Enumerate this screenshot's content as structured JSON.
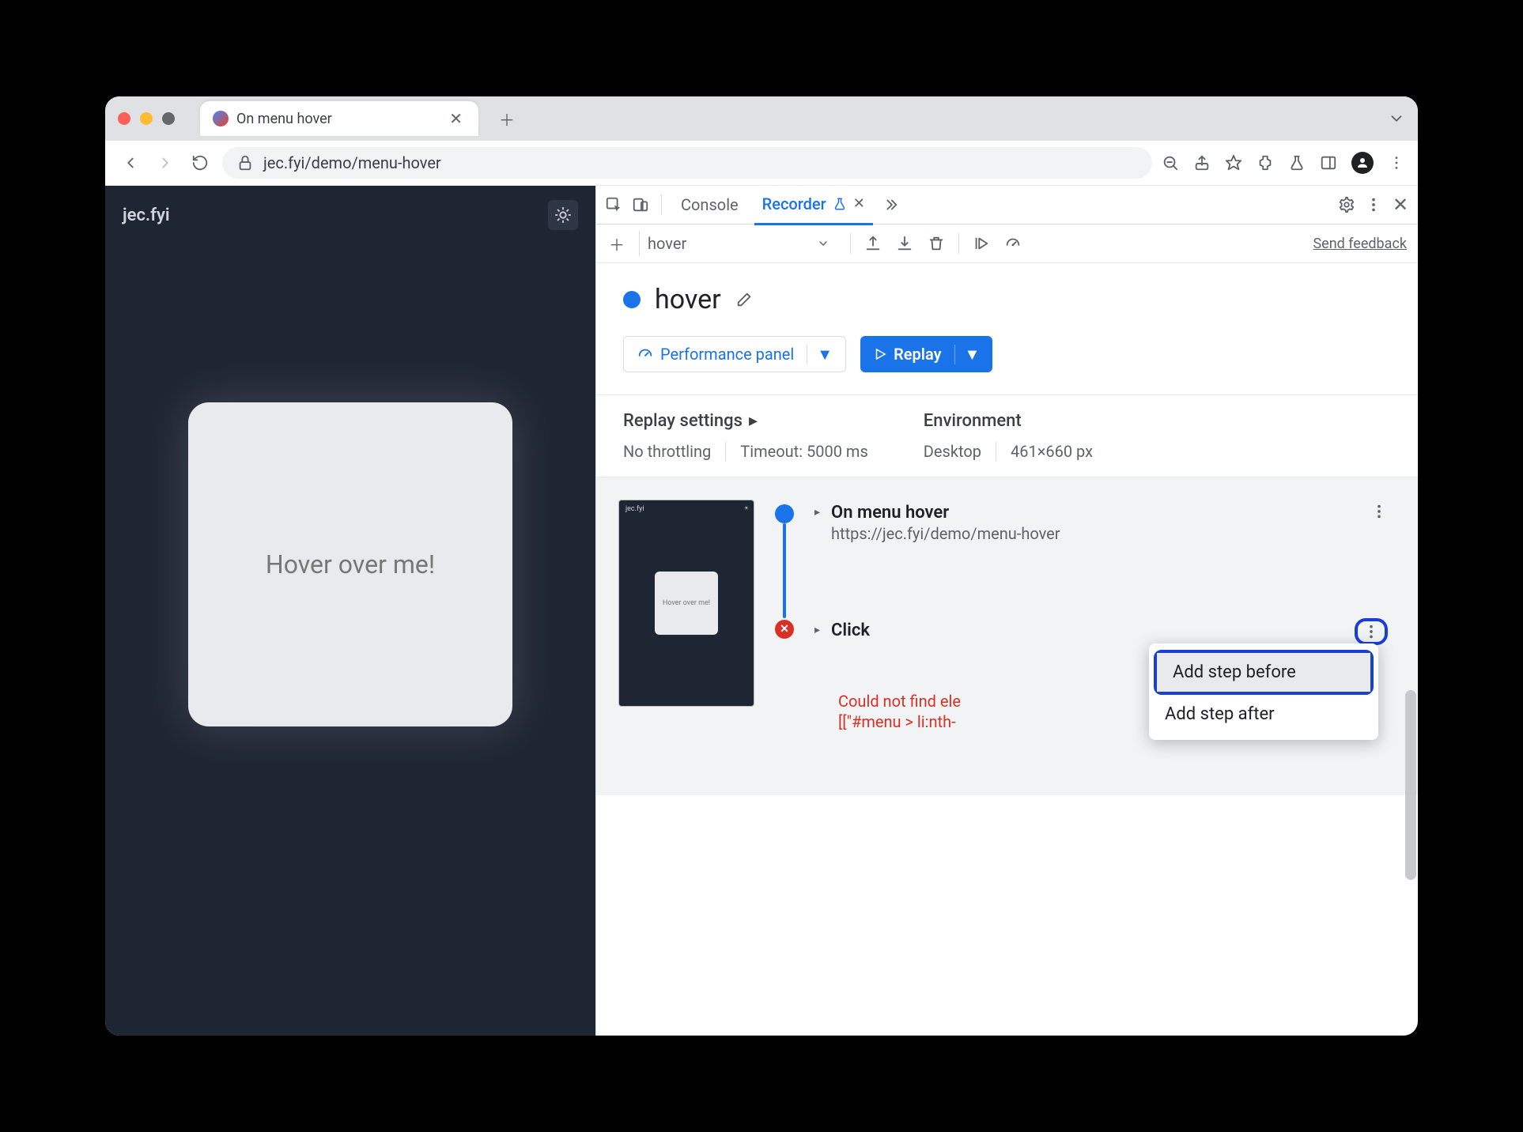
{
  "browser": {
    "tab_title": "On menu hover",
    "url_display": "jec.fyi/demo/menu-hover"
  },
  "page": {
    "site_title": "jec.fyi",
    "card_text": "Hover over me!"
  },
  "devtools": {
    "tabs": {
      "console": "Console",
      "recorder": "Recorder"
    },
    "toolbar": {
      "recording_name": "hover",
      "feedback": "Send feedback"
    },
    "recording": {
      "title": "hover",
      "perf_btn": "Performance panel",
      "replay_btn": "Replay"
    },
    "settings": {
      "replay_title": "Replay settings",
      "throttling": "No throttling",
      "timeout": "Timeout: 5000 ms",
      "env_title": "Environment",
      "device": "Desktop",
      "dimensions": "461×660 px"
    },
    "steps": {
      "s1_title": "On menu hover",
      "s1_url": "https://jec.fyi/demo/menu-hover",
      "s2_title": "Click",
      "error_line1": "Could not find ele",
      "error_line2": "[[\"#menu > li:nth-",
      "thumb_text": "Hover over me!"
    },
    "context_menu": {
      "item1": "Add step before",
      "item2": "Add step after"
    }
  }
}
